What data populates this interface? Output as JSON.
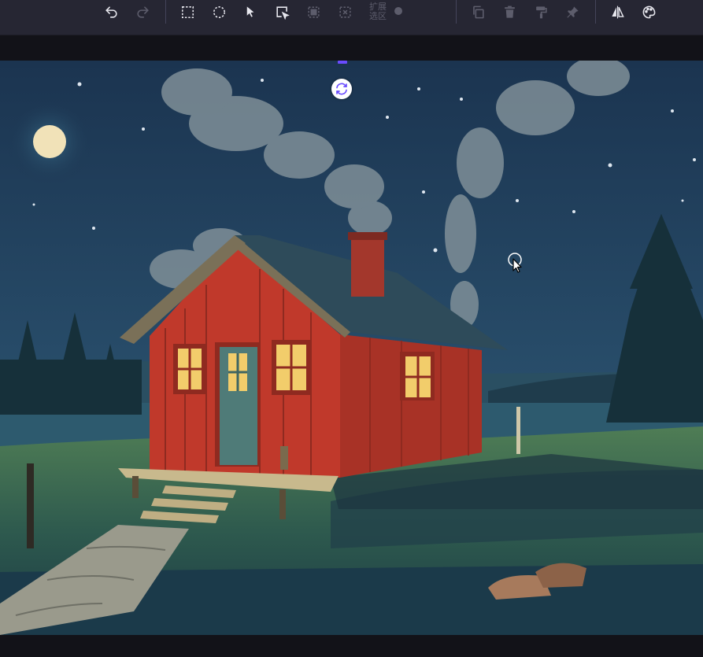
{
  "toolbar": {
    "expand_selection_label": "扩展选区",
    "buttons": [
      {
        "name": "undo-button",
        "icon": "undo-icon",
        "enabled": true
      },
      {
        "name": "redo-button",
        "icon": "redo-icon",
        "enabled": true
      },
      {
        "name": "rect-select-button",
        "icon": "rect-select-icon",
        "enabled": true
      },
      {
        "name": "ellipse-select-button",
        "icon": "ellipse-select-icon",
        "enabled": true
      },
      {
        "name": "pointer-select-button",
        "icon": "pointer-icon",
        "enabled": true
      },
      {
        "name": "object-select-button",
        "icon": "object-select-icon",
        "enabled": true
      },
      {
        "name": "invert-selection-button",
        "icon": "invert-selection-icon",
        "enabled": false
      },
      {
        "name": "clear-selection-button",
        "icon": "clear-selection-icon",
        "enabled": false
      },
      {
        "name": "duplicate-button",
        "icon": "copy-icon",
        "enabled": false
      },
      {
        "name": "delete-button",
        "icon": "trash-icon",
        "enabled": false
      },
      {
        "name": "paint-roller-button",
        "icon": "paint-roller-icon",
        "enabled": false
      },
      {
        "name": "pin-button",
        "icon": "pin-icon",
        "enabled": false
      },
      {
        "name": "flip-button",
        "icon": "flip-icon",
        "enabled": true
      },
      {
        "name": "palette-button",
        "icon": "palette-icon",
        "enabled": true
      }
    ]
  },
  "canvas": {
    "image_subject": "red-cabin-night-scene",
    "colors": {
      "toolbar_bg": "#262633",
      "workspace_bg": "#121218",
      "accent": "#6a4cff",
      "icon_enabled": "#e8e8ef",
      "icon_disabled": "#5d5d6c"
    }
  }
}
